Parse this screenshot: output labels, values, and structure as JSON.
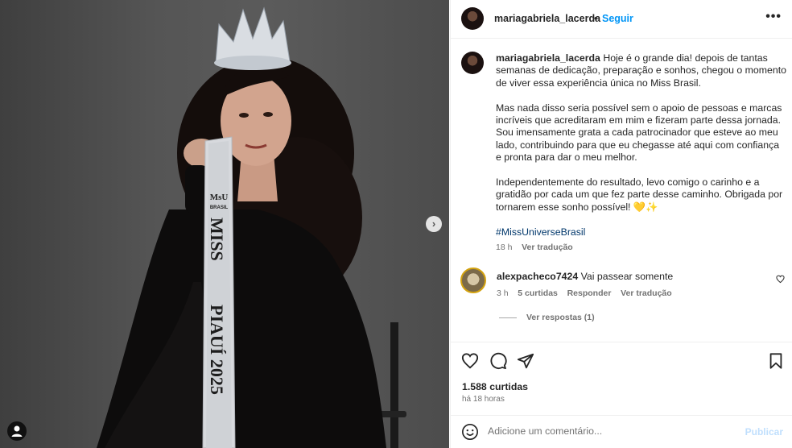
{
  "post": {
    "username": "mariagabriela_lacerda",
    "separator": "•",
    "follow_label": "Seguir",
    "more_label": "•••"
  },
  "photo": {
    "sash_brand": "MsU",
    "sash_country": "BRASIL",
    "sash_line1": "MISS",
    "sash_line2": "PIAUÍ 2025",
    "next_icon": "›"
  },
  "caption": {
    "username": "mariagabriela_lacerda",
    "paragraph1": "Hoje é o grande dia! depois de tantas semanas de dedicação, preparação e sonhos, chegou o momento de viver essa experiência única no Miss Brasil.",
    "paragraph2": "Mas nada disso seria possível sem o apoio de pessoas e marcas incríveis que acreditaram em mim e fizeram parte dessa jornada. Sou imensamente grata a cada patrocinador que esteve ao meu lado, contribuindo para que eu chegasse até aqui com confiança e pronta para dar o meu melhor.",
    "paragraph3": "Independentemente do resultado, levo comigo o carinho e a gratidão por cada um que fez parte desse caminho. Obrigada por tornarem esse sonho possível! 💛✨",
    "hashtag": "#MissUniverseBrasil",
    "age": "18 h",
    "translate": "Ver tradução"
  },
  "comment": {
    "username": "alexpacheco7424",
    "text": "Vai passear somente",
    "age": "3 h",
    "likes": "5 curtidas",
    "reply": "Responder",
    "translate": "Ver tradução",
    "view_replies": "Ver respostas (1)"
  },
  "engagement": {
    "likes": "1.588 curtidas",
    "time": "há 18 horas"
  },
  "add_comment": {
    "placeholder": "Adicione um comentário...",
    "publish": "Publicar"
  },
  "colors": {
    "link_blue": "#0095f6",
    "hashtag_blue": "#00376b",
    "muted": "#737373"
  },
  "icons": [
    "more-icon",
    "next-arrow-icon",
    "user-tag-icon",
    "heart-icon",
    "comment-icon",
    "share-icon",
    "save-icon",
    "emoji-icon"
  ]
}
